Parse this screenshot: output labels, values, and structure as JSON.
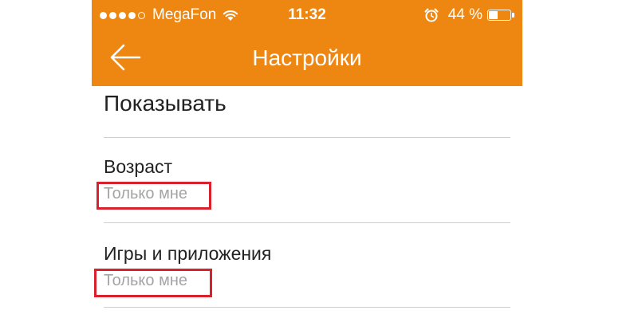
{
  "status_bar": {
    "carrier": "MegaFon",
    "time": "11:32",
    "battery_percent": "44 %",
    "battery_level": 0.44,
    "signal_bars_filled": 4,
    "signal_bars_total": 5
  },
  "nav": {
    "title": "Настройки",
    "back_icon": "arrow-left-icon"
  },
  "colors": {
    "accent": "#ed8712",
    "highlight": "#d8212c"
  },
  "section": {
    "header": "Показывать"
  },
  "rows": [
    {
      "title": "Возраст",
      "value": "Только мне"
    },
    {
      "title": "Игры и приложения",
      "value": "Только мне"
    }
  ]
}
